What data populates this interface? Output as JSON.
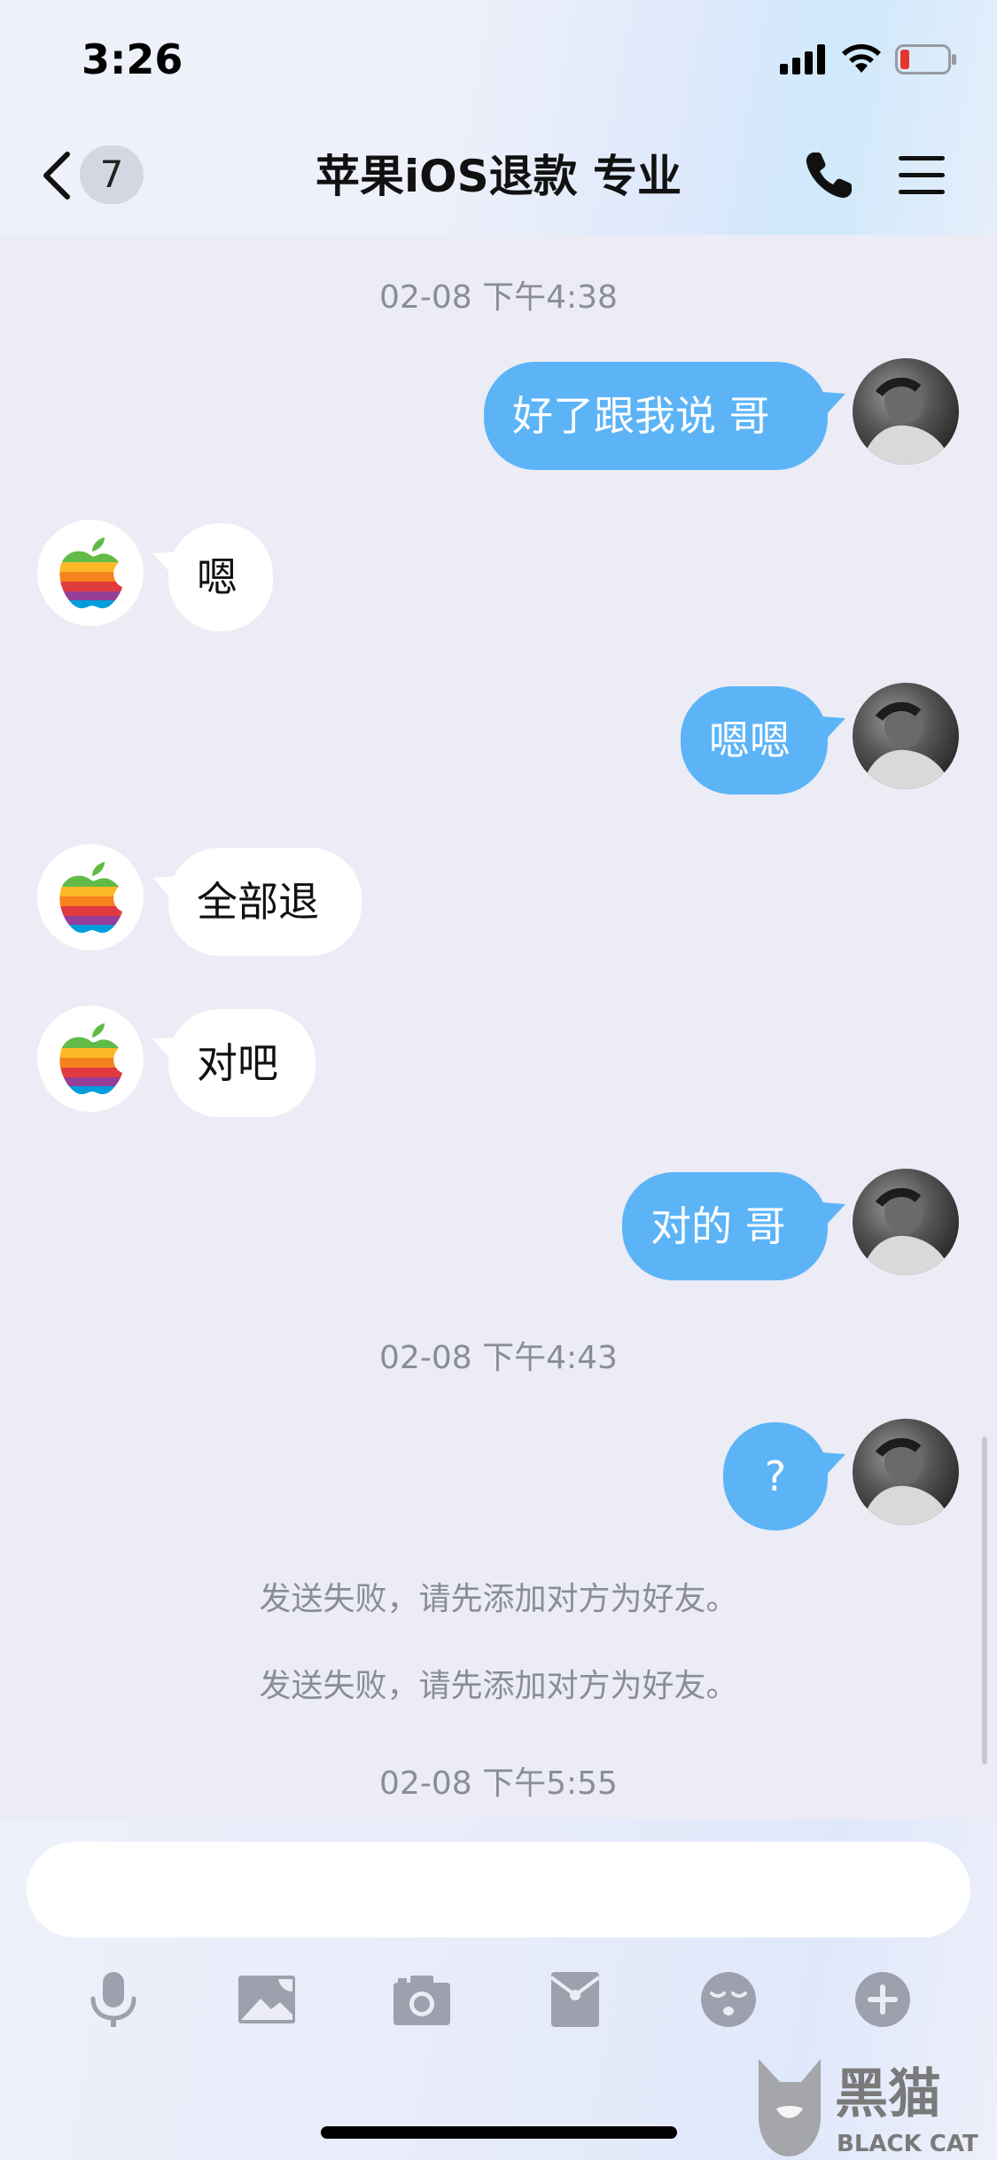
{
  "status_bar": {
    "time": "3:26"
  },
  "nav": {
    "unread_count": "7",
    "title": "苹果iOS退款 专业"
  },
  "messages": [
    {
      "type": "timestamp",
      "text": "02-08 下午4:38"
    },
    {
      "type": "outgoing",
      "text": "好了跟我说 哥"
    },
    {
      "type": "incoming",
      "text": "嗯"
    },
    {
      "type": "outgoing",
      "text": "嗯嗯"
    },
    {
      "type": "incoming",
      "text": "全部退"
    },
    {
      "type": "incoming",
      "text": "对吧"
    },
    {
      "type": "outgoing",
      "text": "对的 哥"
    },
    {
      "type": "timestamp",
      "text": "02-08 下午4:43"
    },
    {
      "type": "outgoing",
      "text": "?"
    },
    {
      "type": "system",
      "text": "发送失败，请先添加对方为好友。"
    },
    {
      "type": "system",
      "text": "发送失败，请先添加对方为好友。"
    },
    {
      "type": "timestamp",
      "text": "02-08 下午5:55"
    }
  ],
  "input": {
    "value": "",
    "placeholder": ""
  },
  "toolbar": {
    "icons": [
      "microphone-icon",
      "image-icon",
      "camera-icon",
      "red-packet-icon",
      "emoji-icon",
      "plus-icon"
    ]
  },
  "watermark": {
    "cn": "黑猫",
    "en": "BLACK CAT"
  },
  "colors": {
    "outgoing_bubble": "#5cb4f7",
    "incoming_bubble": "#ffffff",
    "background": "#ebecf5",
    "meta_text": "#8a8d99"
  }
}
